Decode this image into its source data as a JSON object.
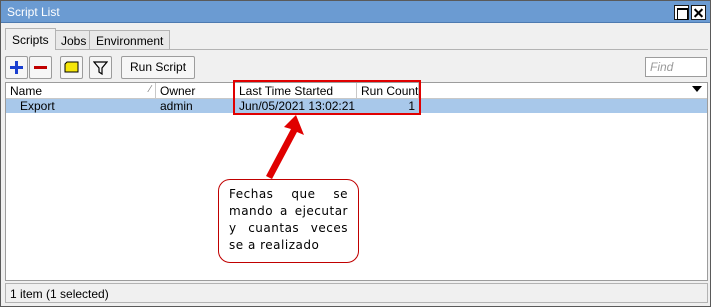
{
  "window": {
    "title": "Script List"
  },
  "tabs": [
    {
      "label": "Scripts",
      "active": true
    },
    {
      "label": "Jobs",
      "active": false
    },
    {
      "label": "Environment",
      "active": false
    }
  ],
  "toolbar": {
    "add_icon": "plus-icon",
    "remove_icon": "minus-icon",
    "comment_icon": "comment-icon",
    "filter_icon": "filter-icon",
    "run_label": "Run Script",
    "find_placeholder": "Find"
  },
  "table": {
    "columns": [
      "Name",
      "Owner",
      "Last Time Started",
      "Run Count"
    ],
    "rows": [
      {
        "name": "Export",
        "owner": "admin",
        "last_started": "Jun/05/2021 13:02:21",
        "run_count": "1",
        "selected": true
      }
    ]
  },
  "status": {
    "text": "1 item (1 selected)"
  },
  "annotation": {
    "text": "Fechas que se mando a ejecutar y cuantas veces se a realizado",
    "color": "#e00000"
  },
  "colors": {
    "titlebar": "#6b9bd2",
    "selected_row": "#a8c8ea",
    "add_icon": "#1a3fd0",
    "remove_icon": "#c00000",
    "comment_icon": "#f5e60a"
  }
}
